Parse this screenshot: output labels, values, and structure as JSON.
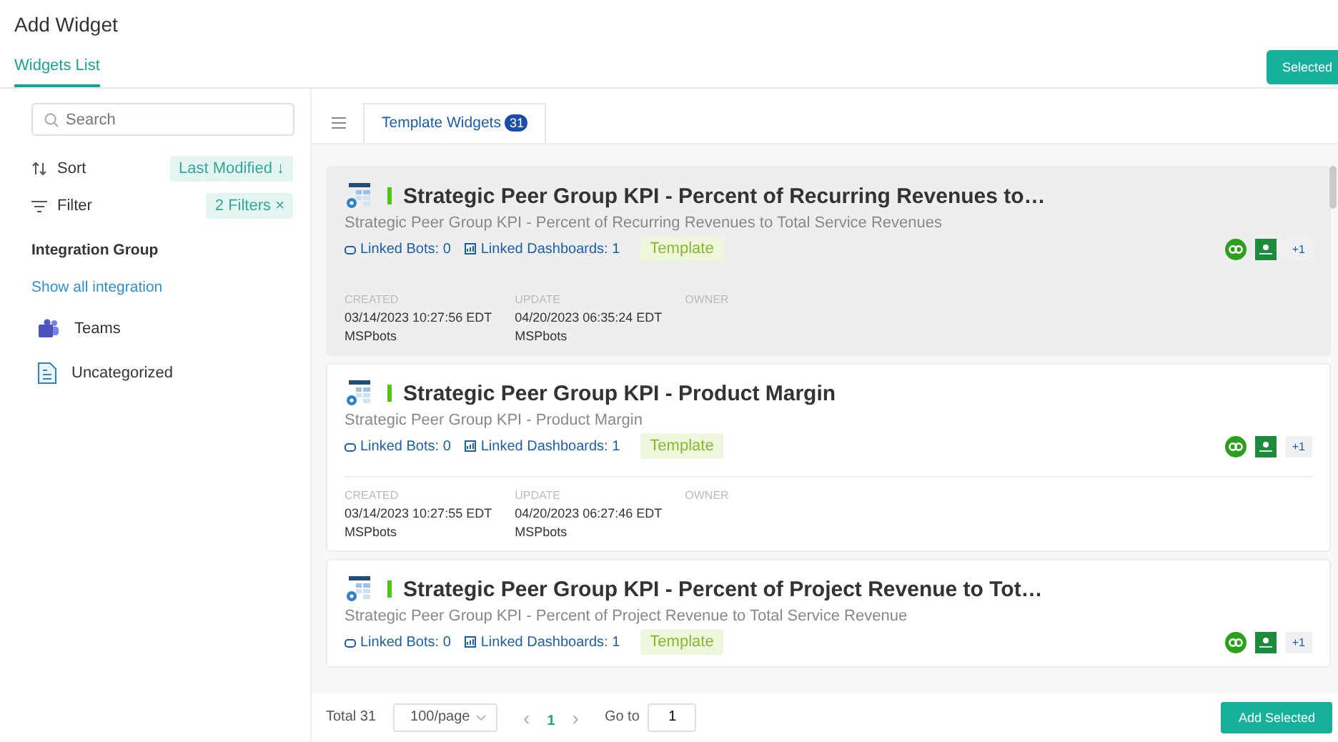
{
  "window": {
    "title": "Add Widget"
  },
  "tabs": [
    {
      "label": "Widgets List",
      "selected": true
    }
  ],
  "selected_button": "Selected",
  "sidebar": {
    "search": {
      "placeholder": "Search"
    },
    "sort": {
      "label": "Sort",
      "value": "Last Modified ↓"
    },
    "filter": {
      "label": "Filter",
      "value": "2 Filters ×"
    },
    "group_title": "Integration Group",
    "show_all": "Show all integration",
    "items": [
      {
        "label": "Teams",
        "kind": "teams"
      },
      {
        "label": "Uncategorized",
        "kind": "doc"
      }
    ]
  },
  "content_tabs": [
    {
      "label": "Template Widgets",
      "count": "31",
      "selected": true
    }
  ],
  "widgets": [
    {
      "title": "Strategic Peer Group KPI - Percent of Recurring Revenues to…",
      "description": "Strategic Peer Group KPI - Percent of Recurring Revenues to Total Service Revenues",
      "linked_bots": "Linked Bots: 0",
      "linked_dashboards": "Linked Dashboards: 1",
      "tag": "Template",
      "extra": "+1",
      "highlighted": true,
      "created_label": "CREATED",
      "created": "03/14/2023 10:27:56 EDT",
      "created_by": "MSPbots",
      "update_label": "UPDATE",
      "updated": "04/20/2023 06:35:24 EDT",
      "updated_by": "MSPbots",
      "owner_label": "OWNER"
    },
    {
      "title": "Strategic Peer Group KPI - Product Margin",
      "description": "Strategic Peer Group KPI - Product Margin",
      "linked_bots": "Linked Bots: 0",
      "linked_dashboards": "Linked Dashboards: 1",
      "tag": "Template",
      "extra": "+1",
      "highlighted": false,
      "created_label": "CREATED",
      "created": "03/14/2023 10:27:55 EDT",
      "created_by": "MSPbots",
      "update_label": "UPDATE",
      "updated": "04/20/2023 06:27:46 EDT",
      "updated_by": "MSPbots",
      "owner_label": "OWNER"
    },
    {
      "title": "Strategic Peer Group KPI - Percent of Project Revenue to Tot…",
      "description": "Strategic Peer Group KPI - Percent of Project Revenue to Total Service Revenue",
      "linked_bots": "Linked Bots: 0",
      "linked_dashboards": "Linked Dashboards: 1",
      "tag": "Template",
      "extra": "+1",
      "highlighted": false
    }
  ],
  "pagination": {
    "total": "Total 31",
    "page_size": "100/page",
    "prev": "‹",
    "pages": [
      {
        "label": "1",
        "selected": true
      }
    ],
    "next": "›",
    "goto_label": "Go to",
    "goto_value": "1"
  },
  "add_button": "Add Selected"
}
